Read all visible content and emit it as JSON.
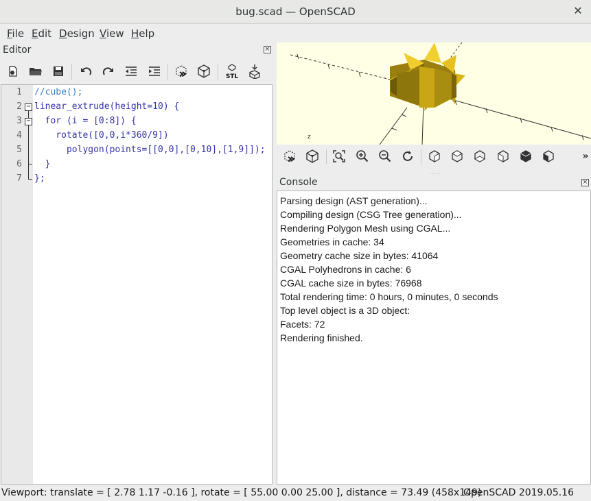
{
  "window": {
    "title": "bug.scad — OpenSCAD",
    "close_glyph": "✕"
  },
  "menu": [
    "File",
    "Edit",
    "Design",
    "View",
    "Help"
  ],
  "editor": {
    "title": "Editor",
    "toolbar_icons": [
      "new-file-icon",
      "open-file-icon",
      "save-icon",
      "undo-icon",
      "redo-icon",
      "unindent-icon",
      "indent-icon",
      "preview-icon",
      "render-icon",
      "export-stl-icon",
      "send-to-3d-print-icon"
    ],
    "stl_label": "STL",
    "lines": [
      {
        "n": "1",
        "text": "//cube();"
      },
      {
        "n": "2",
        "text": "linear_extrude(height=10) {"
      },
      {
        "n": "3",
        "text": "  for (i = [0:8]) {"
      },
      {
        "n": "4",
        "text": "    rotate([0,0,i*360/9])"
      },
      {
        "n": "5",
        "text": "      polygon(points=[[0,0],[0,10],[1,9]]);"
      },
      {
        "n": "6",
        "text": "  }"
      },
      {
        "n": "7",
        "text": "};"
      }
    ]
  },
  "viewport": {
    "background": "#ffffe5",
    "object_color": "#e8c020",
    "toolbar_icons": [
      "preview-icon",
      "render-icon",
      "view-all-icon",
      "zoom-in-icon",
      "zoom-out-icon",
      "reset-view-icon",
      "view-right-icon",
      "view-top-icon",
      "view-bottom-icon",
      "view-left-icon",
      "view-front-icon",
      "view-back-icon",
      "more-icon"
    ]
  },
  "console": {
    "title": "Console",
    "lines": [
      "Parsing design (AST generation)...",
      "Compiling design (CSG Tree generation)...",
      "Rendering Polygon Mesh using CGAL...",
      "Geometries in cache: 34",
      "Geometry cache size in bytes: 41064",
      "CGAL Polyhedrons in cache: 6",
      "CGAL cache size in bytes: 76968",
      "Total rendering time: 0 hours, 0 minutes, 0 seconds",
      "Top level object is a 3D object:",
      "Facets: 72",
      "Rendering finished."
    ]
  },
  "status": {
    "viewport": "Viewport: translate = [ 2.78 1.17 -0.16 ], rotate = [ 55.00 0.00 25.00 ], distance = 73.49 (458x149)",
    "version": "OpenSCAD 2019.05.16"
  }
}
